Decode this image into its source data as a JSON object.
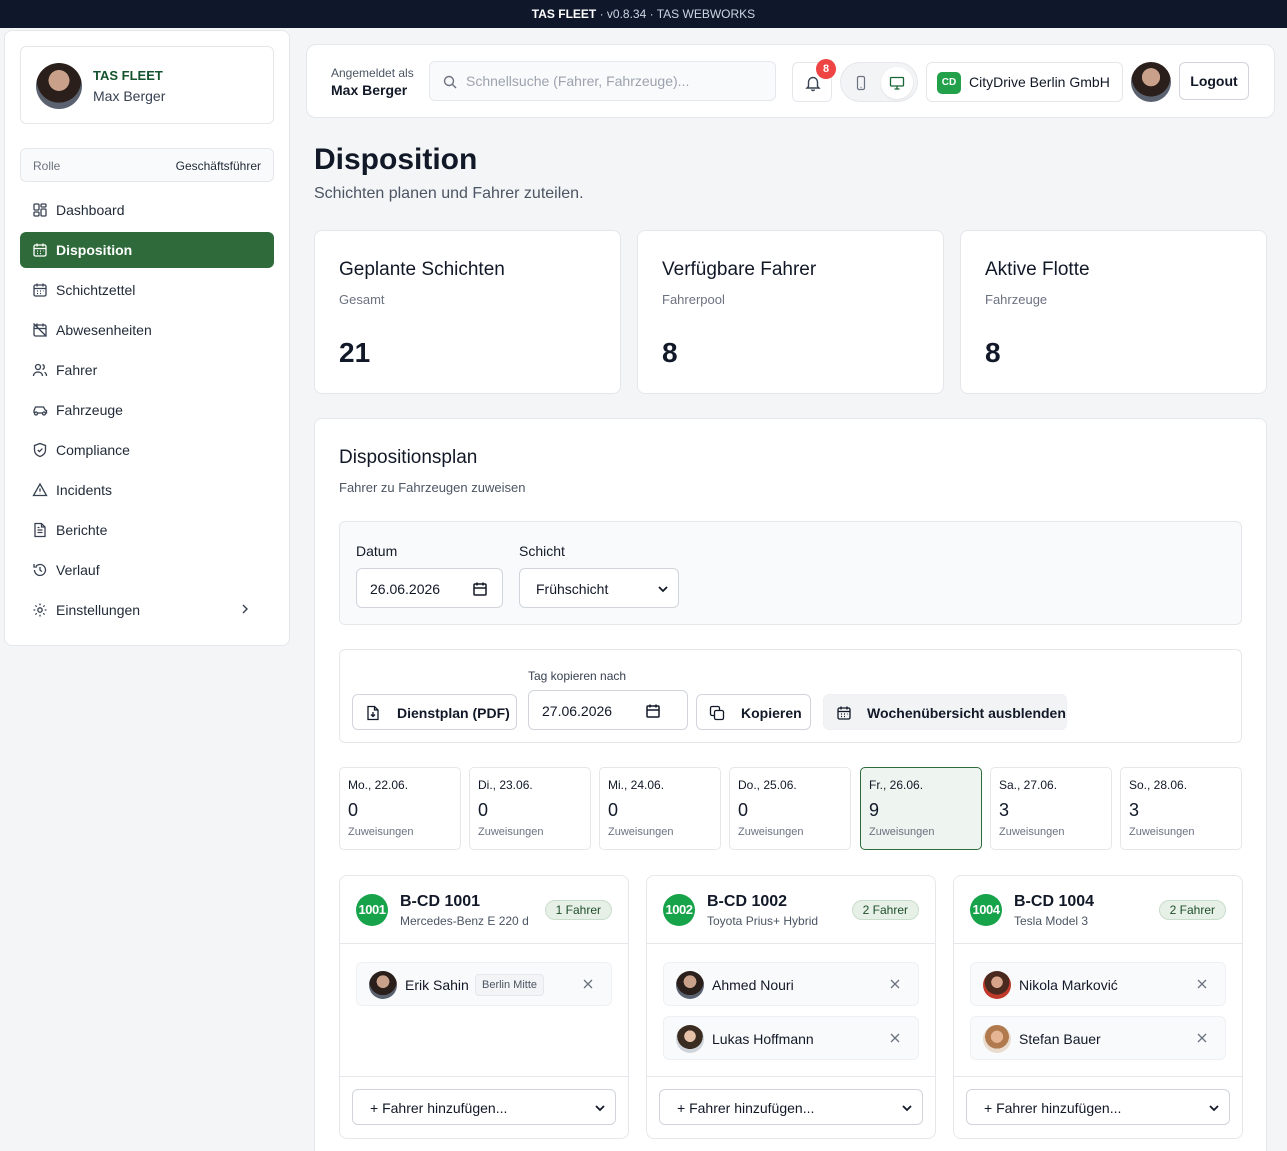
{
  "topbar": {
    "brand": "TAS FLEET",
    "meta": " · v0.8.34 · TAS WEBWORKS"
  },
  "sidebar": {
    "brand_title": "TAS FLEET",
    "brand_user": "Max Berger",
    "role_label": "Rolle",
    "role_value": "Geschäftsführer",
    "items": [
      {
        "label": "Dashboard",
        "icon": "grid-icon"
      },
      {
        "label": "Disposition",
        "icon": "calendar-icon",
        "active": true
      },
      {
        "label": "Schichtzettel",
        "icon": "calendar-icon"
      },
      {
        "label": "Abwesenheiten",
        "icon": "calendar-off-icon"
      },
      {
        "label": "Fahrer",
        "icon": "users-icon"
      },
      {
        "label": "Fahrzeuge",
        "icon": "car-icon"
      },
      {
        "label": "Compliance",
        "icon": "shield-icon"
      },
      {
        "label": "Incidents",
        "icon": "alert-triangle-icon"
      },
      {
        "label": "Berichte",
        "icon": "file-text-icon"
      },
      {
        "label": "Verlauf",
        "icon": "history-icon"
      },
      {
        "label": "Einstellungen",
        "icon": "gear-icon"
      }
    ]
  },
  "header": {
    "login_label": "Angemeldet als",
    "login_name": "Max Berger",
    "search_placeholder": "Schnellsuche (Fahrer, Fahrzeuge)...",
    "notification_count": "8",
    "company_initials": "CD",
    "company_name": "CityDrive Berlin GmbH",
    "logout_label": "Logout"
  },
  "page": {
    "title": "Disposition",
    "subtitle": "Schichten planen und Fahrer zuteilen."
  },
  "stats": [
    {
      "title": "Geplante Schichten",
      "sub": "Gesamt",
      "value": "21"
    },
    {
      "title": "Verfügbare Fahrer",
      "sub": "Fahrerpool",
      "value": "8"
    },
    {
      "title": "Aktive Flotte",
      "sub": "Fahrzeuge",
      "value": "8"
    }
  ],
  "plan": {
    "title": "Dispositionsplan",
    "subtitle": "Fahrer zu Fahrzeugen zuweisen",
    "date_label": "Datum",
    "date_value": "26.06.2026",
    "shift_label": "Schicht",
    "shift_value": "Frühschicht",
    "pdf_label": "Dienstplan (PDF)",
    "copy_to_label": "Tag kopieren nach",
    "copy_to_value": "27.06.2026",
    "copy_label": "Kopieren",
    "week_toggle_label": "Wochenübersicht ausblenden",
    "days": [
      {
        "day": "Mo., 22.06.",
        "count": "0",
        "unit": "Zuweisungen"
      },
      {
        "day": "Di., 23.06.",
        "count": "0",
        "unit": "Zuweisungen"
      },
      {
        "day": "Mi., 24.06.",
        "count": "0",
        "unit": "Zuweisungen"
      },
      {
        "day": "Do., 25.06.",
        "count": "0",
        "unit": "Zuweisungen"
      },
      {
        "day": "Fr., 26.06.",
        "count": "9",
        "unit": "Zuweisungen",
        "selected": true
      },
      {
        "day": "Sa., 27.06.",
        "count": "3",
        "unit": "Zuweisungen"
      },
      {
        "day": "So., 28.06.",
        "count": "3",
        "unit": "Zuweisungen"
      }
    ],
    "vehicles": [
      {
        "num": "1001",
        "plate": "B-CD 1001",
        "model": "Mercedes-Benz E 220 d",
        "badge": "1 Fahrer",
        "drivers": [
          {
            "name": "Erik Sahin",
            "location": "Berlin Mitte"
          }
        ]
      },
      {
        "num": "1002",
        "plate": "B-CD 1002",
        "model": "Toyota Prius+ Hybrid",
        "badge": "2 Fahrer",
        "drivers": [
          {
            "name": "Ahmed Nouri"
          },
          {
            "name": "Lukas Hoffmann"
          }
        ]
      },
      {
        "num": "1004",
        "plate": "B-CD 1004",
        "model": "Tesla Model 3",
        "badge": "2 Fahrer",
        "drivers": [
          {
            "name": "Nikola Marković"
          },
          {
            "name": "Stefan Bauer"
          }
        ]
      }
    ],
    "add_driver_label": "+ Fahrer hinzufügen..."
  },
  "colors": {
    "accent": "#2f6b3a",
    "vehicle_badge": "#16a34a",
    "notification": "#ef4444",
    "topbar": "#0f172a"
  }
}
